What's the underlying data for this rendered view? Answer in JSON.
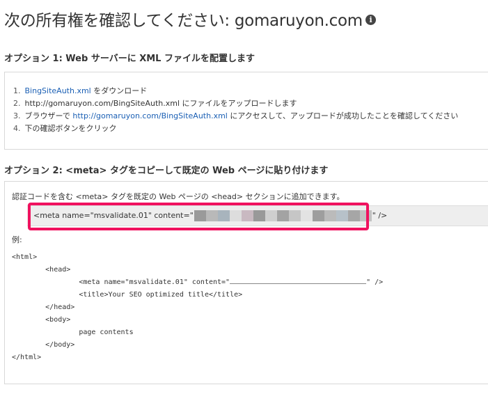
{
  "header": {
    "title": "次の所有権を確認してください: gomaruyon.com",
    "info_icon": "info-icon"
  },
  "option1": {
    "title": "オプション 1: Web サーバーに XML ファイルを配置します",
    "steps": [
      {
        "num": "1.",
        "link": "BingSiteAuth.xml",
        "text": " をダウンロード"
      },
      {
        "num": "2.",
        "text": "http://gomaruyon.com/BingSiteAuth.xml にファイルをアップロードします"
      },
      {
        "num": "3.",
        "prefix": "ブラウザーで ",
        "link": "http://gomaruyon.com/BingSiteAuth.xml",
        "text": " にアクセスして、アップロードが成功したことを確認してください"
      },
      {
        "num": "4.",
        "text": "下の確認ボタンをクリック"
      }
    ]
  },
  "option2": {
    "title": "オプション 2: <meta> タグをコピーして既定の Web ページに貼り付けます",
    "lead": "認証コードを含む <meta> タグを既定の Web ページの <head> セクションに追加できます。",
    "meta_prefix": "<meta name=\"msvalidate.01\" content=\"",
    "meta_suffix": "\" />",
    "mosaic_colors": [
      "#9a9a9a",
      "#b9b9b9",
      "#a8b4bd",
      "#dddddd",
      "#c9b9c1",
      "#999999",
      "#cfcfcf",
      "#a3a3a3",
      "#c6c6c6",
      "#e3e3e3",
      "#9e9e9e",
      "#bbbbbb",
      "#b7c1c9",
      "#a6a6a6",
      "#c2c2c2"
    ],
    "highlight_color": "#f0125f",
    "example_label": "例:",
    "code": {
      "l1": "<html>",
      "l2": "        <head>",
      "l3a": "                <meta name=\"msvalidate.01\" content=\"",
      "l3b": "\" />",
      "l4": "                <title>Your SEO optimized title</title>",
      "l5": "        </head>",
      "l6": "        <body>",
      "l7": "                page contents",
      "l8": "        </body>",
      "l9": "</html>"
    }
  }
}
